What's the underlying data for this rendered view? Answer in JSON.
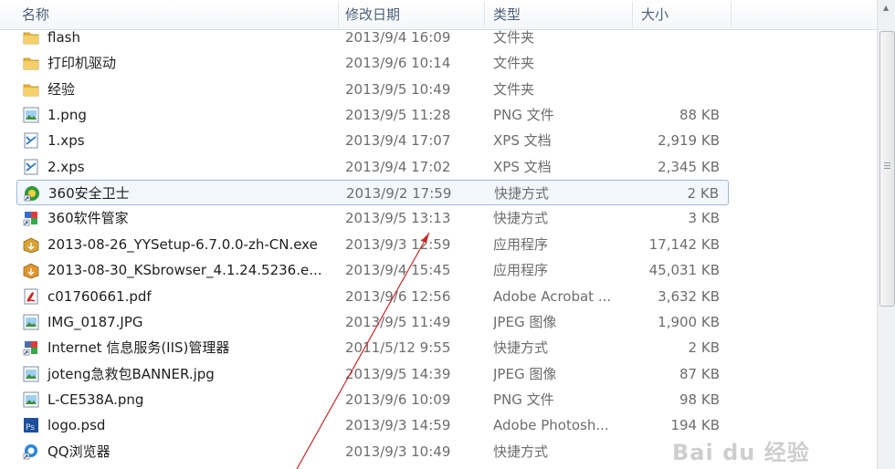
{
  "header": {
    "name": "名称",
    "date": "修改日期",
    "type": "类型",
    "size": "大小"
  },
  "files": [
    {
      "name": "flash",
      "date": "2013/9/4 16:09",
      "type": "文件夹",
      "size": "",
      "icon": "folder-icon",
      "color": "#e8b43a"
    },
    {
      "name": "打印机驱动",
      "date": "2013/9/6 10:14",
      "type": "文件夹",
      "size": "",
      "icon": "folder-icon",
      "color": "#e8b43a"
    },
    {
      "name": "经验",
      "date": "2013/9/5 10:49",
      "type": "文件夹",
      "size": "",
      "icon": "folder-icon",
      "color": "#e8b43a"
    },
    {
      "name": "1.png",
      "date": "2013/9/5 11:28",
      "type": "PNG 文件",
      "size": "88 KB",
      "icon": "image-icon",
      "color": "#3f8f3a"
    },
    {
      "name": "1.xps",
      "date": "2013/9/4 17:07",
      "type": "XPS 文档",
      "size": "2,919 KB",
      "icon": "xps-icon",
      "color": "#3b7fc4"
    },
    {
      "name": "2.xps",
      "date": "2013/9/4 17:02",
      "type": "XPS 文档",
      "size": "2,345 KB",
      "icon": "xps-icon",
      "color": "#3b7fc4"
    },
    {
      "name": "360安全卫士",
      "date": "2013/9/2 17:59",
      "type": "快捷方式",
      "size": "2 KB",
      "icon": "shortcut-360-icon",
      "color": "#2f9a3a"
    },
    {
      "name": "360软件管家",
      "date": "2013/9/5 13:13",
      "type": "快捷方式",
      "size": "3 KB",
      "icon": "shortcut-app-icon",
      "color": "#2f6fd0"
    },
    {
      "name": "2013-08-26_YYSetup-6.7.0.0-zh-CN.exe",
      "date": "2013/9/3 12:59",
      "type": "应用程序",
      "size": "17,142 KB",
      "icon": "installer-icon",
      "color": "#d9a233"
    },
    {
      "name": "2013-08-30_KSbrowser_4.1.24.5236.e...",
      "date": "2013/9/4 15:45",
      "type": "应用程序",
      "size": "45,031 KB",
      "icon": "installer-icon",
      "color": "#e0952e"
    },
    {
      "name": "c01760661.pdf",
      "date": "2013/9/6 12:56",
      "type": "Adobe Acrobat ...",
      "size": "3,632 KB",
      "icon": "pdf-icon",
      "color": "#cc2222"
    },
    {
      "name": "IMG_0187.JPG",
      "date": "2013/9/5 11:49",
      "type": "JPEG 图像",
      "size": "1,900 KB",
      "icon": "image-icon",
      "color": "#3f8f3a"
    },
    {
      "name": "Internet 信息服务(IIS)管理器",
      "date": "2011/5/12 9:55",
      "type": "快捷方式",
      "size": "2 KB",
      "icon": "shortcut-app-icon",
      "color": "#4a6fa5"
    },
    {
      "name": "joteng急救包BANNER.jpg",
      "date": "2013/9/5 14:39",
      "type": "JPEG 图像",
      "size": "87 KB",
      "icon": "image-icon",
      "color": "#3f8f3a"
    },
    {
      "name": "L-CE538A.png",
      "date": "2013/9/6 10:09",
      "type": "PNG 文件",
      "size": "98 KB",
      "icon": "image-icon",
      "color": "#3f8f3a"
    },
    {
      "name": "logo.psd",
      "date": "2013/9/3 14:59",
      "type": "Adobe Photosh...",
      "size": "194 KB",
      "icon": "psd-icon",
      "color": "#1f4f9a"
    },
    {
      "name": "QQ浏览器",
      "date": "2013/9/3 10:49",
      "type": "快捷方式",
      "size": "",
      "icon": "shortcut-browser-icon",
      "color": "#2c86d8"
    }
  ],
  "selected_index": 6,
  "watermark": "Bai du 经验"
}
